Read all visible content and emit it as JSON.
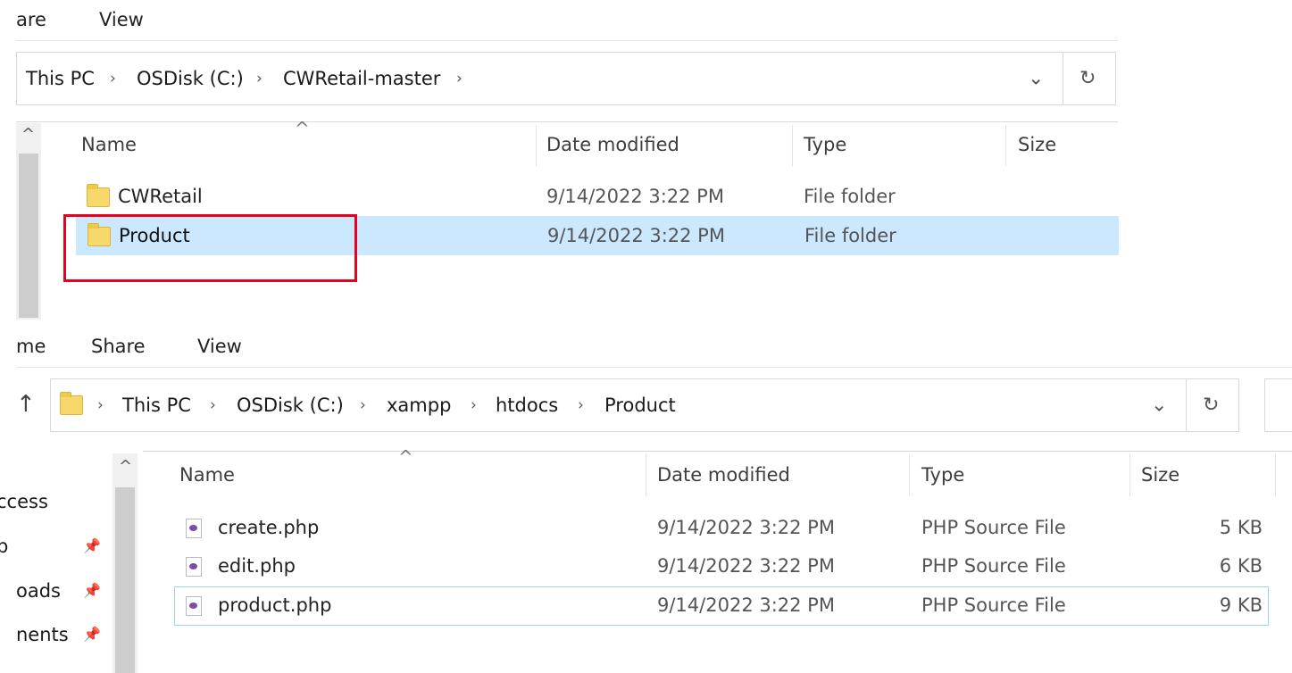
{
  "top": {
    "ribbon": [
      "are",
      "View"
    ],
    "breadcrumb": [
      "This PC",
      "OSDisk (C:)",
      "CWRetail-master"
    ],
    "columns": [
      "Name",
      "Date modified",
      "Type",
      "Size"
    ],
    "rows": [
      {
        "name": "CWRetail",
        "date": "9/14/2022 3:22 PM",
        "type": "File folder",
        "size": ""
      },
      {
        "name": "Product",
        "date": "9/14/2022 3:22 PM",
        "type": "File folder",
        "size": ""
      }
    ]
  },
  "bottom": {
    "ribbon": [
      "me",
      "Share",
      "View"
    ],
    "breadcrumb": [
      "This PC",
      "OSDisk (C:)",
      "xampp",
      "htdocs",
      "Product"
    ],
    "columns": [
      "Name",
      "Date modified",
      "Type",
      "Size"
    ],
    "nav": [
      "ccess",
      "p",
      "oads",
      "nents"
    ],
    "rows": [
      {
        "name": "create.php",
        "date": "9/14/2022 3:22 PM",
        "type": "PHP Source File",
        "size": "5 KB"
      },
      {
        "name": "edit.php",
        "date": "9/14/2022 3:22 PM",
        "type": "PHP Source File",
        "size": "6 KB"
      },
      {
        "name": "product.php",
        "date": "9/14/2022 3:22 PM",
        "type": "PHP Source File",
        "size": "9 KB"
      }
    ]
  },
  "icons": {
    "chevron_right": "›",
    "chevron_down": "⌄",
    "refresh": "↻",
    "up_arrow": "↑",
    "sort_caret": "^",
    "scroll_up": "^",
    "pin": "📌"
  },
  "colors": {
    "selection": "#cce8ff",
    "selection_border": "#99d1ff",
    "highlight_box": "#e8001c"
  }
}
